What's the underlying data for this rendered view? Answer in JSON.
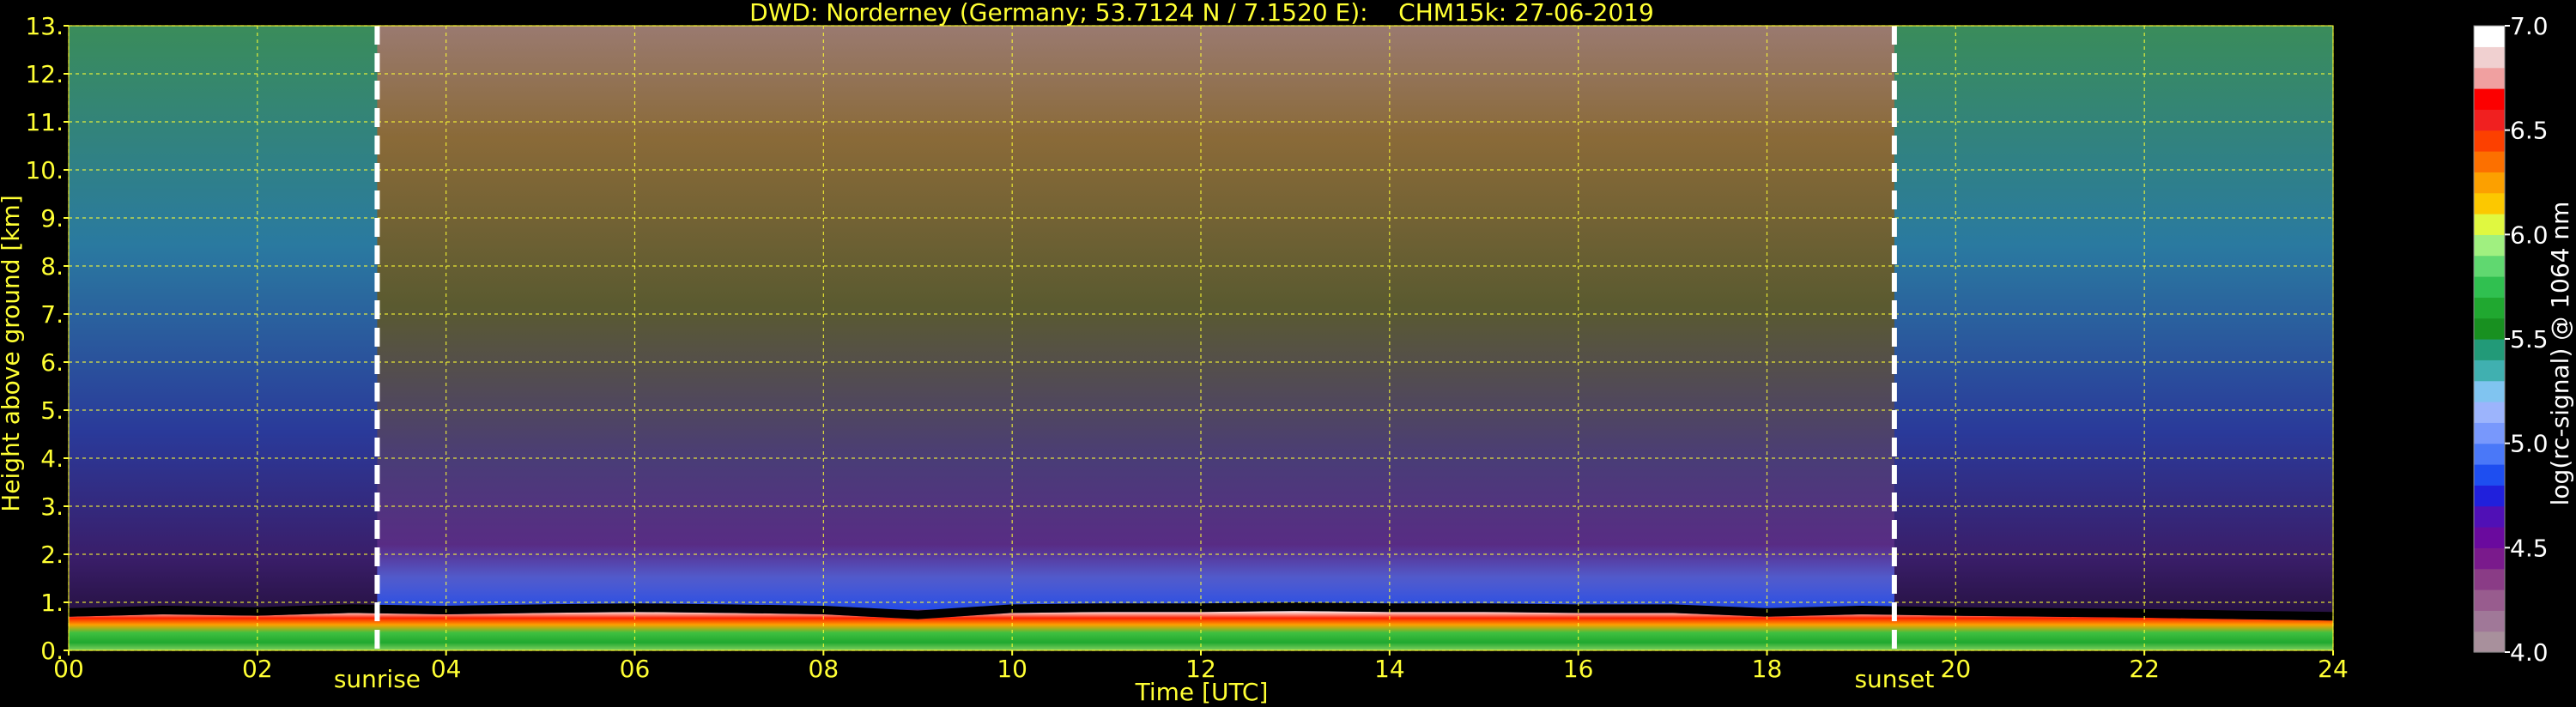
{
  "chart_data": {
    "type": "heatmap",
    "title": "DWD: Norderney (Germany; 53.7124 N / 7.1520 E):    CHM15k: 27-06-2019",
    "xlabel": "Time [UTC]",
    "ylabel": "Height above ground [km]",
    "xlim": [
      0,
      24
    ],
    "ylim": [
      0,
      13
    ],
    "x_ticks": [
      0,
      2,
      4,
      6,
      8,
      10,
      12,
      14,
      16,
      18,
      20,
      22,
      24
    ],
    "x_tick_labels": [
      "00",
      "02",
      "04",
      "06",
      "08",
      "10",
      "12",
      "14",
      "16",
      "18",
      "20",
      "22",
      "24"
    ],
    "y_ticks": [
      0,
      1,
      2,
      3,
      4,
      5,
      6,
      7,
      8,
      9,
      10,
      11,
      12,
      13
    ],
    "y_tick_labels": [
      "0.",
      "1.",
      "2.",
      "3.",
      "4.",
      "5.",
      "6.",
      "7.",
      "8.",
      "9.",
      "10.",
      "11.",
      "12.",
      "13."
    ],
    "grid": true,
    "colorbar": {
      "label": "log(rc-signal) @ 1064 nm",
      "range": [
        4.0,
        7.0
      ],
      "ticks": [
        4.0,
        4.5,
        5.0,
        5.5,
        6.0,
        6.5,
        7.0
      ],
      "tick_labels": [
        "4.0",
        "4.5",
        "5.0",
        "5.5",
        "6.0",
        "6.5",
        "7.0"
      ],
      "colors": [
        "#a8909c",
        "#a07898",
        "#985c8e",
        "#8a3c86",
        "#7a1a8c",
        "#6a0a9e",
        "#5010b6",
        "#2020dc",
        "#1e4ef0",
        "#4a78f8",
        "#7898fc",
        "#9cb4fc",
        "#80c4f0",
        "#40b0b0",
        "#229a78",
        "#189020",
        "#20a830",
        "#30c050",
        "#60d870",
        "#a0f080",
        "#e0f840",
        "#fcc800",
        "#fca000",
        "#fc7000",
        "#fc4000",
        "#f02020",
        "#fc0000",
        "#f0a0a0",
        "#f0d0d0",
        "#ffffff"
      ]
    },
    "annotations": [
      {
        "text": "sunrise",
        "x": 3.27
      },
      {
        "text": "sunset",
        "x": 19.35
      }
    ],
    "boundary_layer_top_km": [
      0.7,
      0.75,
      0.72,
      0.78,
      0.75,
      0.78,
      0.8,
      0.78,
      0.75,
      0.65,
      0.78,
      0.8,
      0.8,
      0.82,
      0.8,
      0.8,
      0.78,
      0.78,
      0.7,
      0.75,
      0.72,
      0.7,
      0.68,
      0.65,
      0.62
    ]
  }
}
